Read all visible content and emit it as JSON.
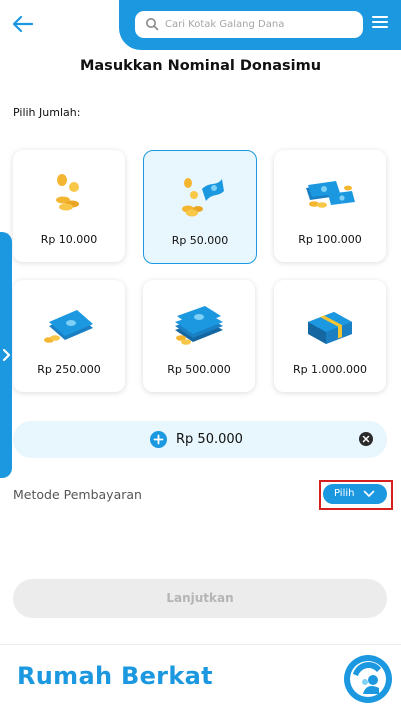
{
  "header": {
    "search_placeholder": "Cari Kotak Galang Dana"
  },
  "page": {
    "title": "Masukkan Nominal Donasimu",
    "pick_label": "Pilih Jumlah:"
  },
  "amounts": [
    {
      "label": "Rp 10.000",
      "icon": "coins-icon",
      "selected": false
    },
    {
      "label": "Rp 50.000",
      "icon": "coins-bill-icon",
      "selected": true
    },
    {
      "label": "Rp 100.000",
      "icon": "bills-coins-icon",
      "selected": false
    },
    {
      "label": "Rp 250.000",
      "icon": "bill-stack-coins-icon",
      "selected": false
    },
    {
      "label": "Rp 500.000",
      "icon": "money-pile-icon",
      "selected": false
    },
    {
      "label": "Rp 1.000.000",
      "icon": "money-bundle-icon",
      "selected": false
    }
  ],
  "custom_amount": {
    "value": "Rp 50.000"
  },
  "payment": {
    "label": "Metode Pembayaran",
    "pick_label": "Pilih"
  },
  "actions": {
    "continue_label": "Lanjutkan"
  },
  "footer": {
    "brand": "Rumah Berkat"
  },
  "colors": {
    "accent": "#1b98e0",
    "selected_bg": "#e8f6fd",
    "highlight_outline": "#d62020",
    "disabled_bg": "#ececec"
  }
}
